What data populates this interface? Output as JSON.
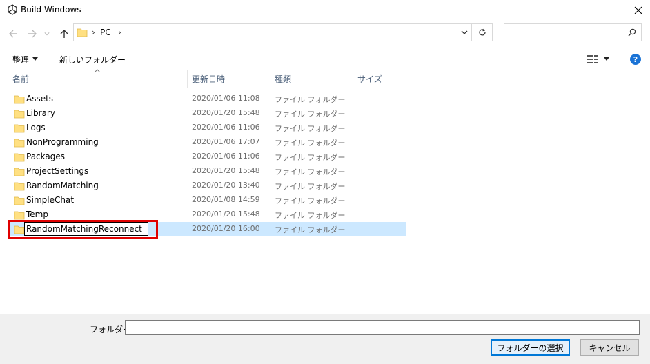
{
  "window": {
    "title": "Build Windows",
    "accent": "#0078d7"
  },
  "nav": {
    "breadcrumb": [
      "PC"
    ],
    "search_placeholder": ""
  },
  "toolbar": {
    "organize_label": "整理",
    "new_folder_label": "新しいフォルダー"
  },
  "columns": {
    "name": "名前",
    "date": "更新日時",
    "type": "種類",
    "size": "サイズ"
  },
  "files": [
    {
      "name": "Assets",
      "date": "2020/01/06 11:08",
      "type": "ファイル フォルダー"
    },
    {
      "name": "Library",
      "date": "2020/01/20 15:48",
      "type": "ファイル フォルダー"
    },
    {
      "name": "Logs",
      "date": "2020/01/06 11:06",
      "type": "ファイル フォルダー"
    },
    {
      "name": "NonProgramming",
      "date": "2020/01/06 17:07",
      "type": "ファイル フォルダー"
    },
    {
      "name": "Packages",
      "date": "2020/01/06 11:06",
      "type": "ファイル フォルダー"
    },
    {
      "name": "ProjectSettings",
      "date": "2020/01/20 15:48",
      "type": "ファイル フォルダー"
    },
    {
      "name": "RandomMatching",
      "date": "2020/01/20 13:40",
      "type": "ファイル フォルダー"
    },
    {
      "name": "SimpleChat",
      "date": "2020/01/08 14:59",
      "type": "ファイル フォルダー"
    },
    {
      "name": "Temp",
      "date": "2020/01/20 15:48",
      "type": "ファイル フォルダー"
    },
    {
      "name": "RandomMatchingReconnect",
      "date": "2020/01/20 16:00",
      "type": "ファイル フォルダー",
      "selected": true,
      "renaming": true
    }
  ],
  "bottom": {
    "folder_label": "フォルダー:",
    "folder_value": "",
    "select_button": "フォルダーの選択",
    "cancel_button": "キャンセル"
  }
}
